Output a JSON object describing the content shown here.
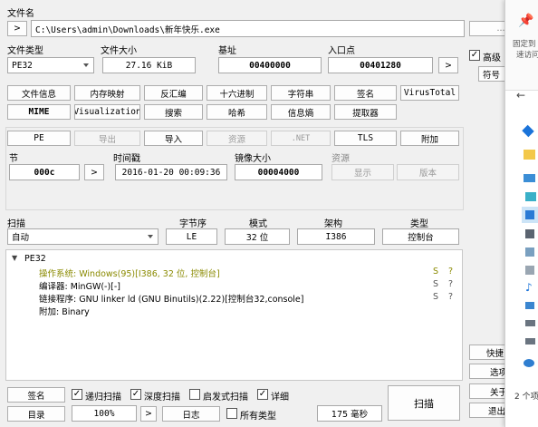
{
  "file": {
    "label": "文件名",
    "browse_label": ">",
    "path": "C:\\Users\\admin\\Downloads\\新年快乐.exe",
    "more_label": "..."
  },
  "info": {
    "type_label": "文件类型",
    "type_value": "PE32",
    "size_label": "文件大小",
    "size_value": "27.16 KiB",
    "base_label": "基址",
    "base_value": "00400000",
    "entry_label": "入口点",
    "entry_value": "00401280",
    "entry_btn": ">",
    "advanced_label": "高级",
    "advanced_checked": "✓",
    "symbols_label": "符号"
  },
  "toolbar1": [
    "文件信息",
    "内存映射",
    "反汇编",
    "十六进制",
    "字符串",
    "签名",
    "VirusTotal"
  ],
  "toolbar2": [
    "MIME",
    "Visualization",
    "搜索",
    "哈希",
    "信息熵",
    "提取器"
  ],
  "pe_buttons": {
    "pe": "PE",
    "export": "导出",
    "import": "导入",
    "resource": "资源",
    "net": ".NET",
    "tls": "TLS",
    "overlay": "附加"
  },
  "section": {
    "section_label": "节",
    "section_value": "000c",
    "section_btn": ">",
    "time_label": "时间戳",
    "time_value": "2016-01-20 00:09:36",
    "image_size_label": "镜像大小",
    "image_size_value": "00004000",
    "resource_label": "资源",
    "show_label": "显示",
    "version_label": "版本"
  },
  "scan": {
    "scan_label": "扫描",
    "mode_value": "自动",
    "endian_label": "字节序",
    "endian_value": "LE",
    "mode_label": "模式",
    "bits_value": "32 位",
    "arch_label": "架构",
    "arch_value": "I386",
    "type_label": "类型",
    "type_value": "控制台"
  },
  "results": {
    "root": "PE32",
    "items": [
      {
        "text": "操作系统: Windows(95)[I386, 32 位, 控制台]",
        "flag": "S",
        "q": "?"
      },
      {
        "text": "编译器: MinGW(-)[-]",
        "flag": "S",
        "q": "?"
      },
      {
        "text": "链接程序: GNU linker ld (GNU Binutils)(2.22)[控制台32,console]",
        "flag": "S",
        "q": "?"
      },
      {
        "text": "附加: Binary",
        "flag": "",
        "q": ""
      }
    ],
    "os_color": "#8a8a00"
  },
  "bottom": {
    "signature": "签名",
    "recursive": "递归扫描",
    "recursive_checked": "✓",
    "deep": "深度扫描",
    "deep_checked": "✓",
    "heuristic": "启发式扫描",
    "verbose": "详细",
    "verbose_checked": "✓",
    "directory": "目录",
    "zoom": "100%",
    "zoom_btn": ">",
    "log": "日志",
    "all_types": "所有类型",
    "elapsed": "175 毫秒",
    "scan_btn": "扫描"
  },
  "side": {
    "shortcuts": "快捷",
    "options": "选项",
    "about": "关于",
    "exit": "退出"
  },
  "explorer": {
    "pin_line1": "固定到",
    "pin_line2": "速访问",
    "back": "←",
    "count": "2 个项"
  }
}
